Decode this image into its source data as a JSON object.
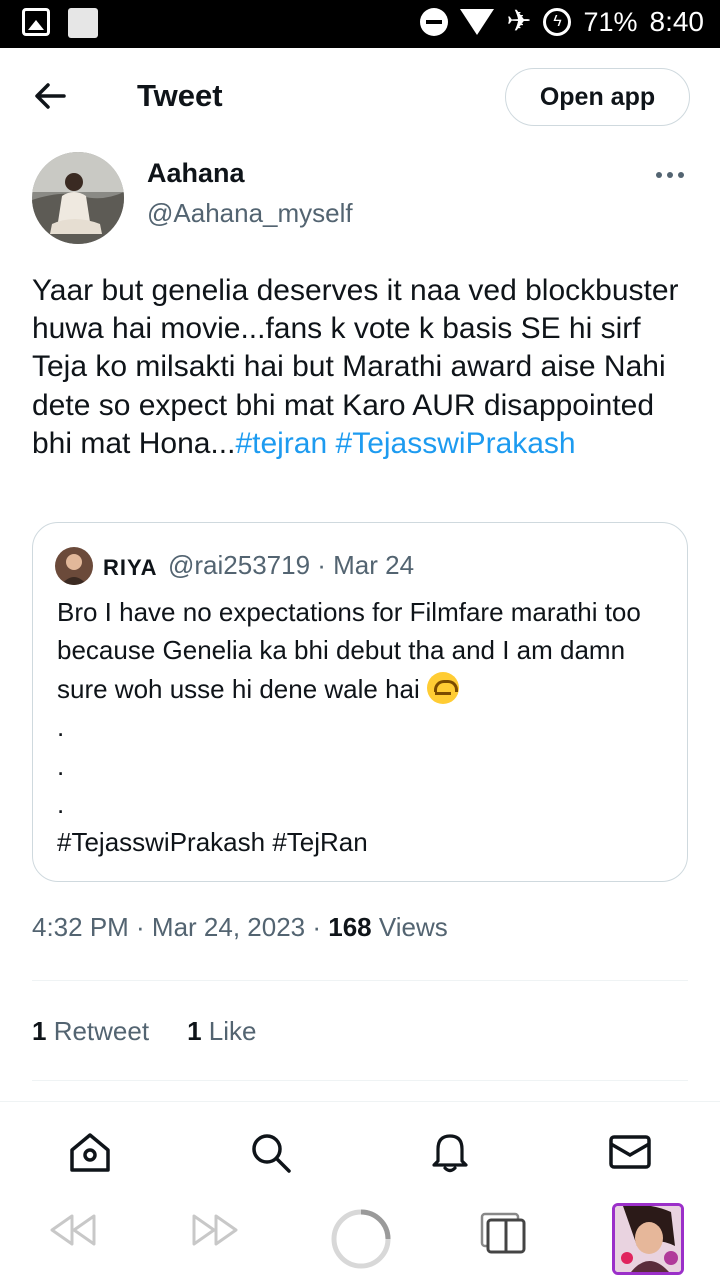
{
  "status_bar": {
    "battery": "71%",
    "time": "8:40"
  },
  "header": {
    "title": "Tweet",
    "open_app_label": "Open app"
  },
  "author": {
    "name": "Aahana",
    "handle": "@Aahana_myself"
  },
  "tweet": {
    "text": "Yaar but genelia deserves it naa ved blockbuster huwa hai movie...fans k vote k basis SE hi sirf Teja ko milsakti hai but Marathi award aise Nahi dete so expect bhi mat Karo AUR disappointed bhi mat Hona...",
    "hashtag1": "#tejran",
    "hashtag2": "#TejasswiPrakash"
  },
  "quote": {
    "name": "RIYA",
    "handle_date": "@rai253719 · Mar 24",
    "line1": "Bro I have no expectations for Filmfare marathi too because Genelia ka bhi debut tha and I am damn sure woh usse hi dene wale hai",
    "dot": ".",
    "hashtags": "#TejasswiPrakash #TejRan"
  },
  "meta": {
    "timestamp": "4:32 PM · Mar 24, 2023 · ",
    "views_count": "168",
    "views_label": " Views"
  },
  "stats": {
    "retweet_count": "1",
    "retweet_label": " Retweet",
    "like_count": "1",
    "like_label": " Like"
  },
  "colors": {
    "link": "#1d9bf0",
    "secondary_text": "#536471",
    "border": "#cfd9de"
  },
  "icons": {
    "bottom_nav": [
      "home-icon",
      "search-icon",
      "bell-icon",
      "mail-icon"
    ],
    "browser": [
      "rewind-icon",
      "forward-icon",
      "loading-icon",
      "tabs-icon"
    ]
  }
}
